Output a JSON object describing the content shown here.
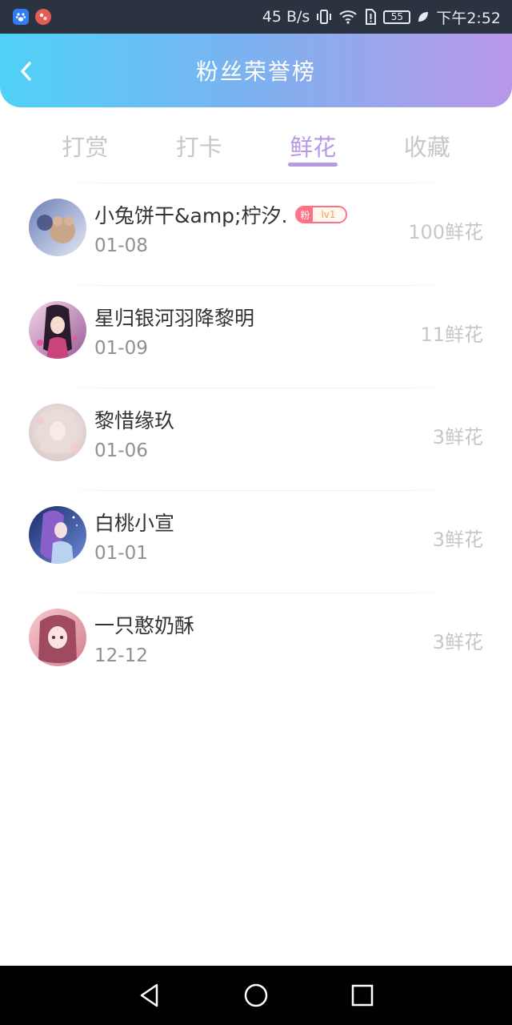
{
  "status_bar": {
    "app_icons": [
      "baidu-icon",
      "notification-app-icon"
    ],
    "network_speed": "45 B/s",
    "battery_level": "55",
    "time": "下午2:52"
  },
  "header": {
    "title": "粉丝荣誉榜",
    "gradient_start": "#4fd2f7",
    "gradient_end": "#b997e8"
  },
  "tabs": [
    {
      "label": "打赏",
      "active": false
    },
    {
      "label": "打卡",
      "active": false
    },
    {
      "label": "鲜花",
      "active": true
    },
    {
      "label": "收藏",
      "active": false
    }
  ],
  "ranking": [
    {
      "name": "小兔饼干&amp;柠汐.",
      "date": "01-08",
      "amount": "100鲜花",
      "badge": {
        "fan": "粉",
        "level": "lv1"
      }
    },
    {
      "name": "星归银河羽降黎明",
      "date": "01-09",
      "amount": "11鲜花"
    },
    {
      "name": "黎惜缘玖",
      "date": "01-06",
      "amount": "3鲜花"
    },
    {
      "name": "白桃小宣",
      "date": "01-01",
      "amount": "3鲜花"
    },
    {
      "name": "一只憨奶酥",
      "date": "12-12",
      "amount": "3鲜花"
    }
  ],
  "colors": {
    "accent": "#b69ae2",
    "inactive_tab": "#c7c7c7",
    "badge": "#ff6f86"
  }
}
